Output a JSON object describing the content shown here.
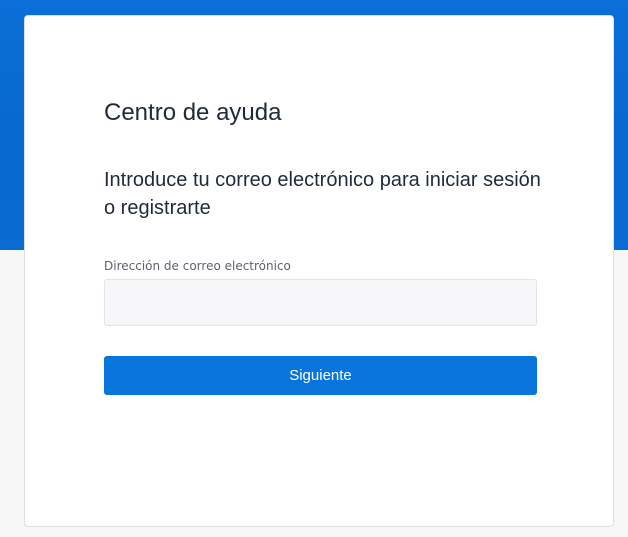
{
  "page": {
    "title": "Centro de ayuda",
    "subtitle": "Introduce tu correo electrónico para iniciar sesión o registrarte"
  },
  "form": {
    "email_label": "Dirección de correo electrónico",
    "email_value": "",
    "email_placeholder": "",
    "next_button_label": "Siguiente"
  },
  "colors": {
    "brand_blue": "#0a74dd",
    "background": "#f7f7f8",
    "text_dark": "#1f2a3a"
  }
}
